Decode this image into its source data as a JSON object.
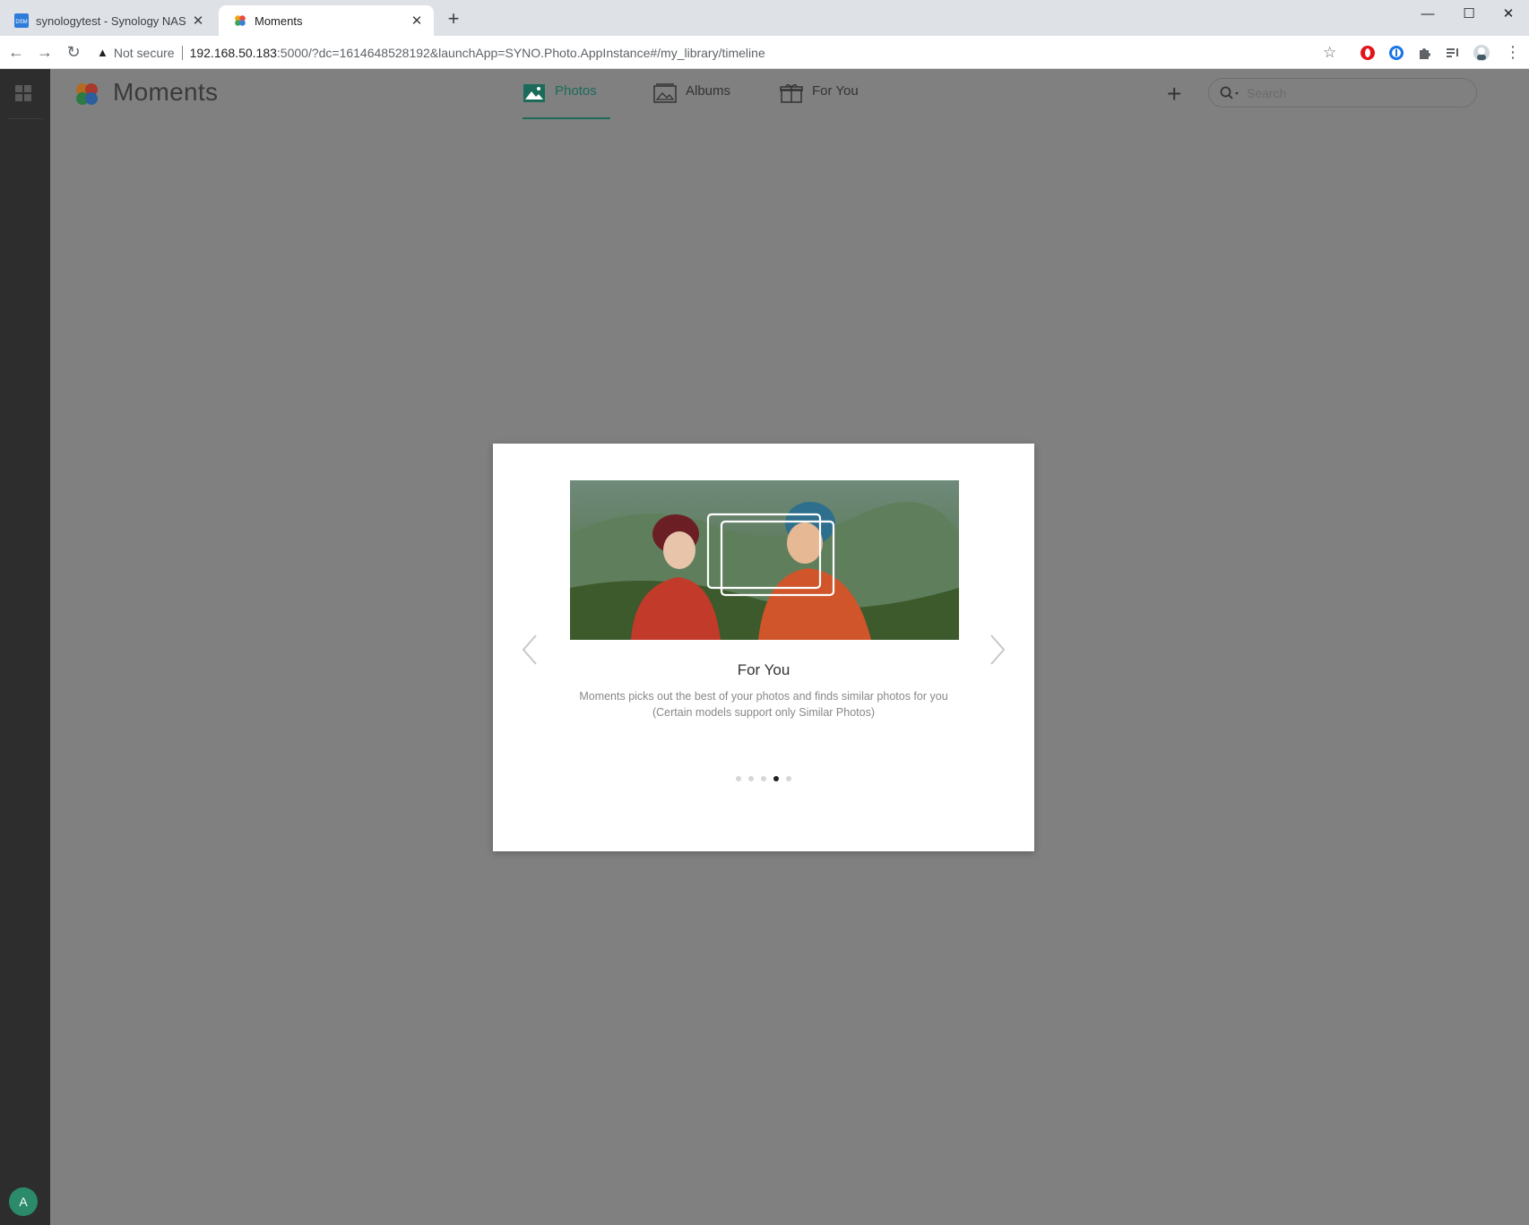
{
  "browser": {
    "tabs": [
      {
        "title": "synologytest - Synology NAS",
        "favicon": "dsm-icon",
        "active": false
      },
      {
        "title": "Moments",
        "favicon": "moments-icon",
        "active": true
      }
    ],
    "new_tab": "+",
    "address": {
      "security": "Not secure",
      "host": "192.168.50.183",
      "path": ":5000/?dc=1614648528192&launchApp=SYNO.Photo.AppInstance#/my_library/timeline"
    },
    "window_controls": [
      "minimize",
      "maximize",
      "close"
    ]
  },
  "sidebar": {
    "avatar_initial": "A"
  },
  "app": {
    "name": "Moments",
    "nav": [
      {
        "label": "Photos",
        "icon": "photos-icon",
        "active": true
      },
      {
        "label": "Albums",
        "icon": "albums-icon",
        "active": false
      },
      {
        "label": "For You",
        "icon": "gift-icon",
        "active": false
      }
    ],
    "search_placeholder": "Search",
    "accent_color": "#1a6b5a"
  },
  "modal": {
    "title": "For You",
    "description_line1": "Moments picks out the best of your photos and finds similar photos for you",
    "description_line2": "(Certain models support only Similar Photos)",
    "page_count": 5,
    "current_page": 4
  }
}
